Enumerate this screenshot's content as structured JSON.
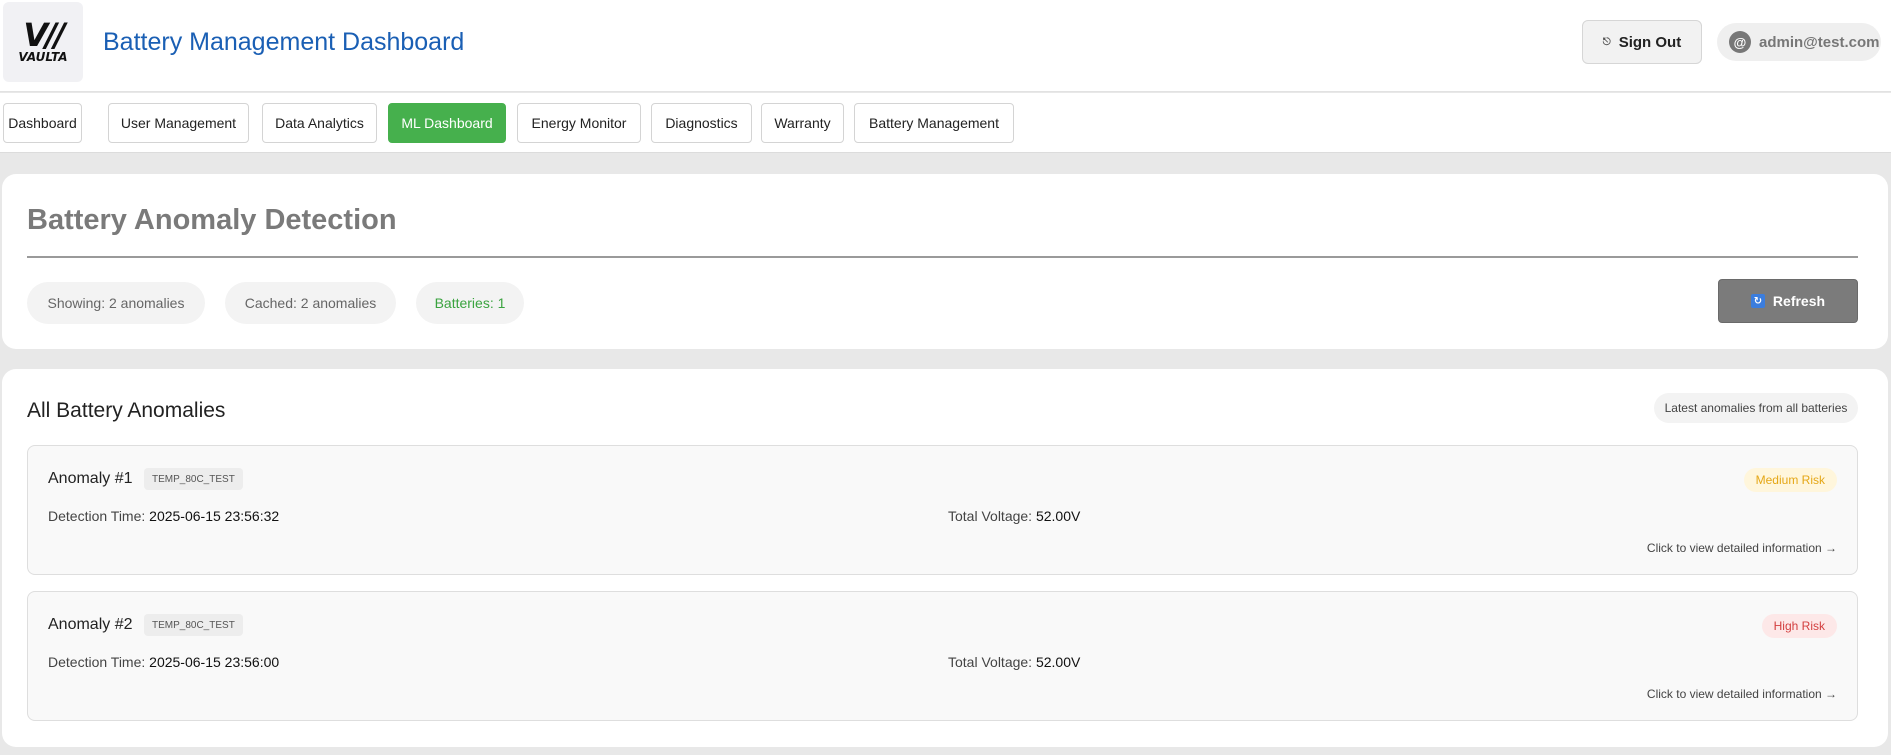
{
  "header": {
    "logo_mark": "V//",
    "logo_word": "VAULTA",
    "title": "Battery Management Dashboard",
    "sign_out_label": "Sign Out",
    "sign_out_icon": "power-icon",
    "user_email": "admin@test.com",
    "user_icon": "@"
  },
  "nav": {
    "tabs": [
      {
        "label": "Dashboard",
        "active": false
      },
      {
        "label": "User Management",
        "active": false
      },
      {
        "label": "Data Analytics",
        "active": false
      },
      {
        "label": "ML Dashboard",
        "active": true
      },
      {
        "label": "Energy Monitor",
        "active": false
      },
      {
        "label": "Diagnostics",
        "active": false
      },
      {
        "label": "Warranty",
        "active": false
      },
      {
        "label": "Battery Management",
        "active": false
      }
    ]
  },
  "detection": {
    "title": "Battery Anomaly Detection",
    "showing": "Showing: 2 anomalies",
    "cached": "Cached: 2 anomalies",
    "batteries": "Batteries: 1",
    "refresh_label": "Refresh",
    "refresh_icon": "🔄"
  },
  "list": {
    "title": "All Battery Anomalies",
    "hint": "Latest anomalies from all batteries",
    "detection_time_label": "Detection Time:",
    "total_voltage_label": "Total Voltage:",
    "detail_link": "Click to view detailed information →",
    "anomalies": [
      {
        "title": "Anomaly #1",
        "tag": "TEMP_80C_TEST",
        "risk": "Medium Risk",
        "detection_time": "2025-06-15 23:56:32",
        "voltage": "52.00V"
      },
      {
        "title": "Anomaly #2",
        "tag": "TEMP_80C_TEST",
        "risk": "High Risk",
        "detection_time": "2025-06-15 23:56:00",
        "voltage": "52.00V"
      }
    ]
  },
  "colors": {
    "accent_blue": "#1a5fb4",
    "active_green": "#46b04d",
    "medium_risk": "#e5a716",
    "high_risk": "#d33f3f"
  }
}
